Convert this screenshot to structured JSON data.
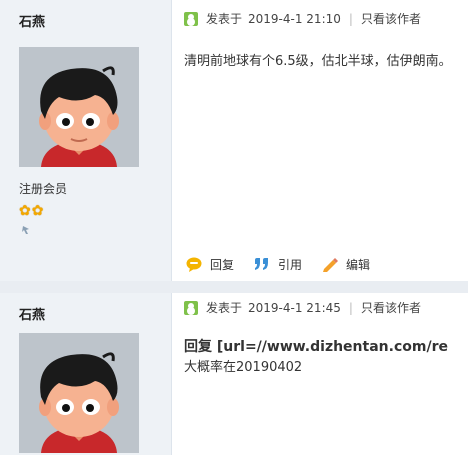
{
  "posts": [
    {
      "author": "石燕",
      "usergroup": "注册会员",
      "post_label": "发表于",
      "timestamp": "2019-4-1 21:10",
      "view_author_only": "只看该作者",
      "body": "清明前地球有个6.5级，估北半球，估伊朗南。",
      "actions": {
        "reply": "回复",
        "quote": "引用",
        "edit": "编辑"
      }
    },
    {
      "author": "石燕",
      "post_label": "发表于",
      "timestamp": "2019-4-1 21:45",
      "view_author_only": "只看该作者",
      "reply_header": "回复 [url=//www.dizhentan.com/re",
      "body": "大概率在20190402"
    }
  ],
  "colors": {
    "sidebar_bg": "#eef2f6",
    "divider_bg": "#e9edf2",
    "meta_icon": "#7fc14a",
    "star": "#f3a800"
  }
}
